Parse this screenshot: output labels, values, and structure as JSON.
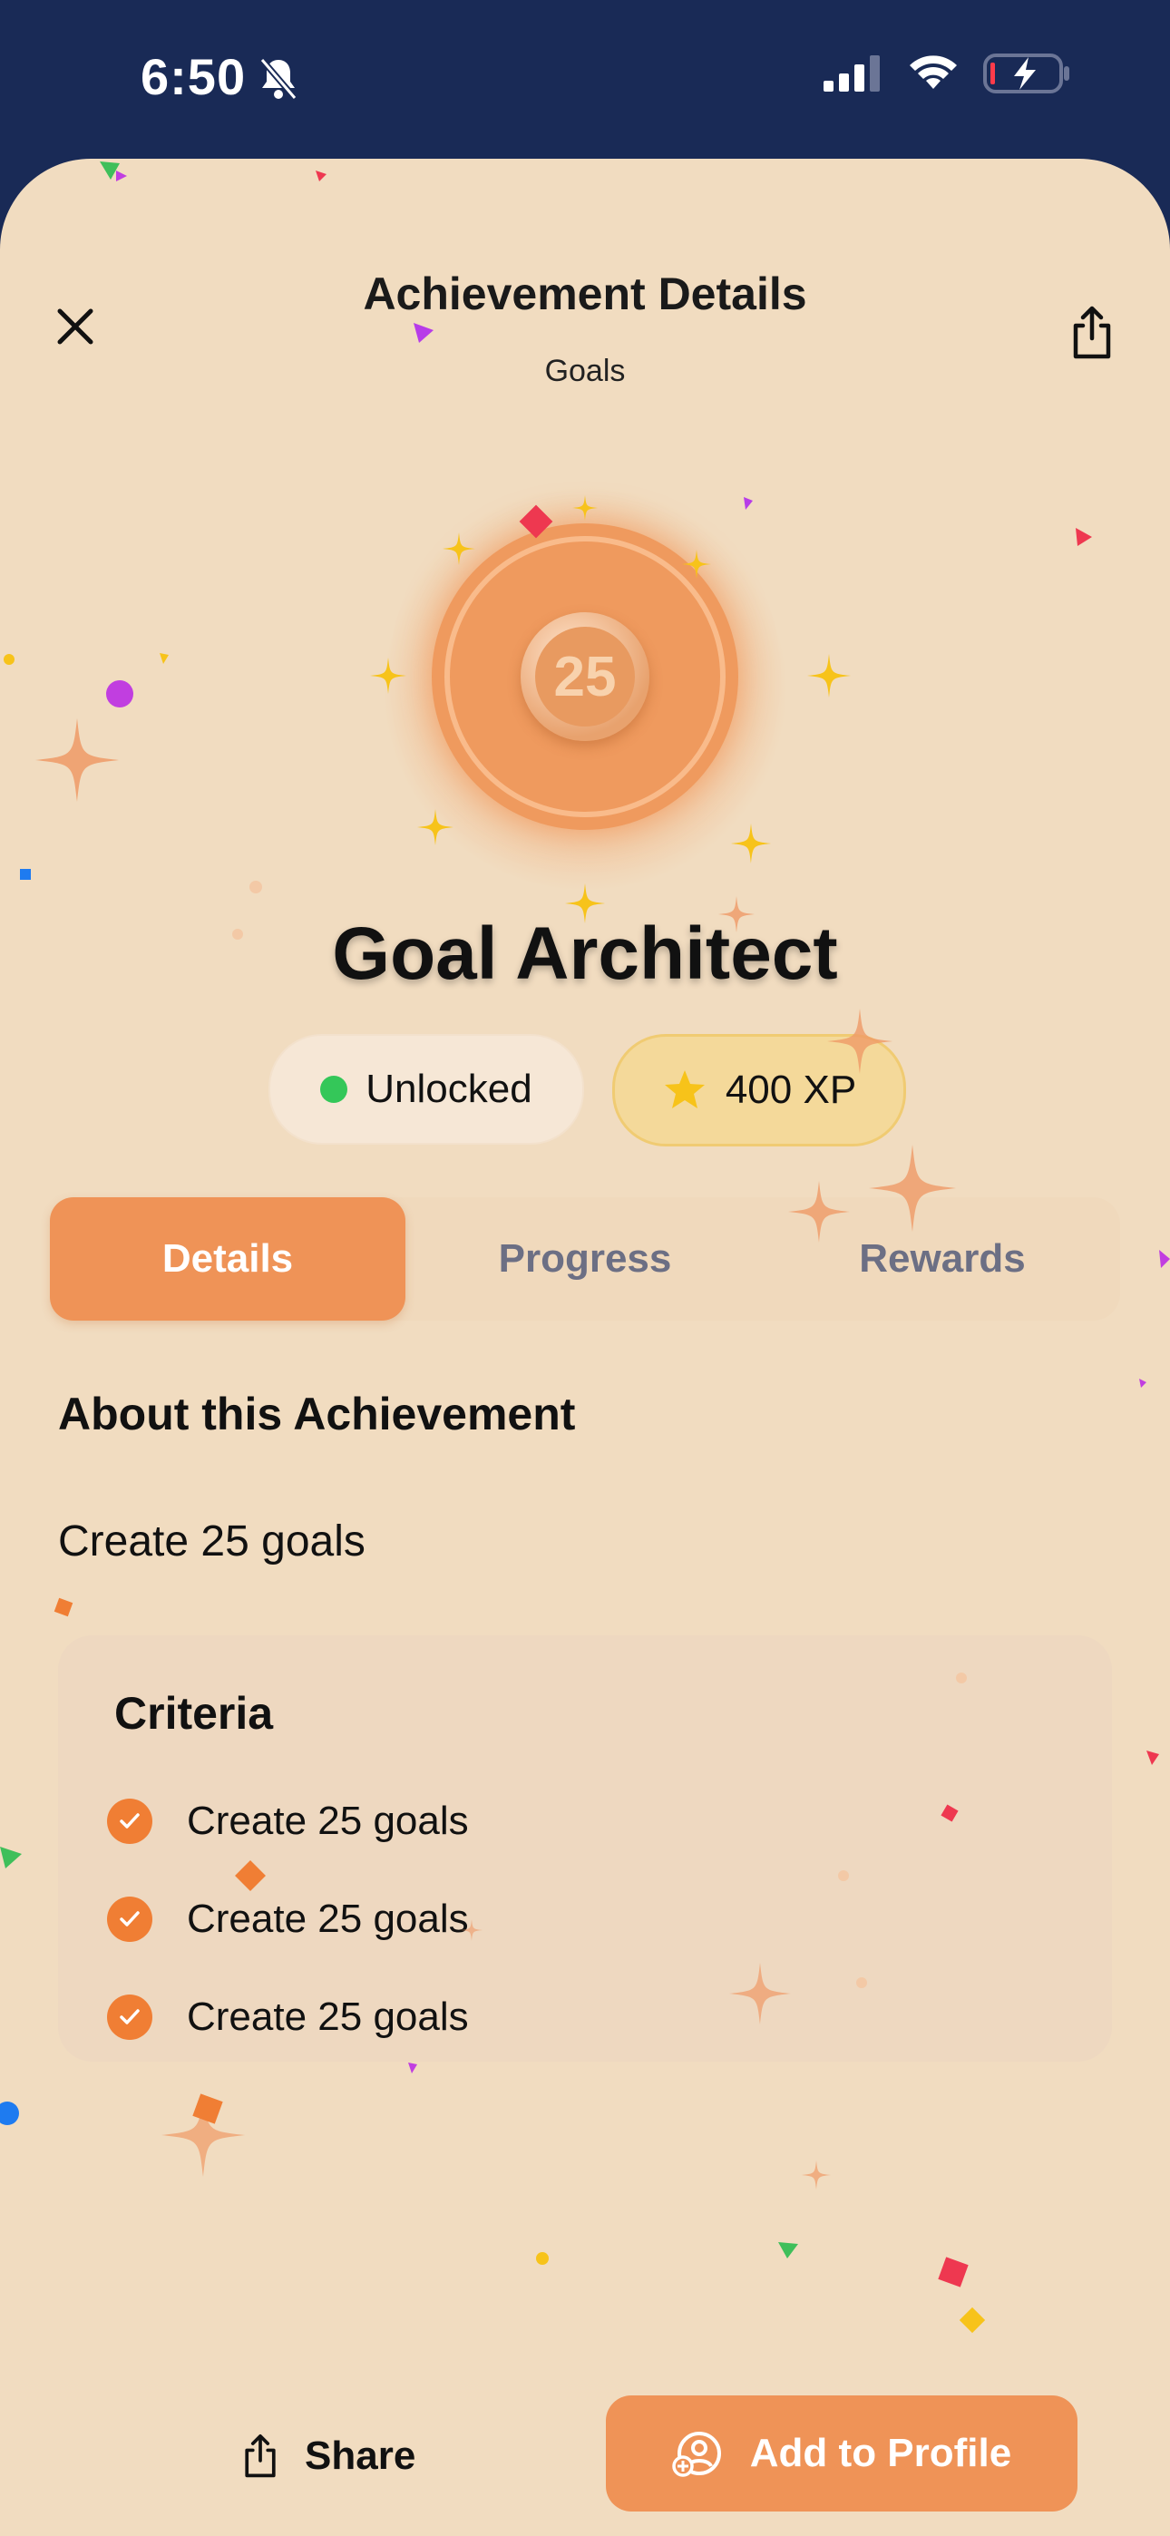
{
  "status_bar": {
    "time": "6:50",
    "icons": [
      "bell-slash-icon",
      "signal-icon",
      "wifi-icon",
      "battery-charging-icon"
    ]
  },
  "header": {
    "title": "Achievement Details",
    "subtitle": "Goals",
    "close_icon": "close-icon",
    "share_icon": "share-icon"
  },
  "achievement": {
    "badge_number": "25",
    "name": "Goal Architect",
    "status": "Unlocked",
    "xp": "400 XP"
  },
  "tabs": [
    {
      "label": "Details",
      "active": true
    },
    {
      "label": "Progress",
      "active": false
    },
    {
      "label": "Rewards",
      "active": false
    }
  ],
  "about": {
    "heading": "About this Achievement",
    "description": "Create 25 goals"
  },
  "criteria": {
    "title": "Criteria",
    "items": [
      "Create 25 goals",
      "Create 25 goals",
      "Create 25 goals"
    ]
  },
  "actions": {
    "share_label": "Share",
    "add_label": "Add to Profile"
  },
  "colors": {
    "accent": "#ef9357",
    "background": "#f1dcc0",
    "status_bar": "#192a56",
    "unlocked_dot": "#34c759",
    "xp_pill": "#f4d99a"
  }
}
